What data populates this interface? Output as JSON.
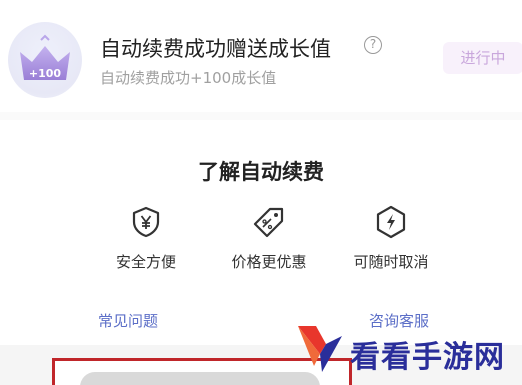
{
  "task": {
    "badge_text": "+100",
    "title": "自动续费成功赠送成长值",
    "help_symbol": "?",
    "subtitle": "自动续费成功+100成长值",
    "status": "进行中"
  },
  "info": {
    "title": "了解自动续费",
    "features": [
      {
        "label": "安全方便",
        "icon": "shield-yen-icon"
      },
      {
        "label": "价格更优惠",
        "icon": "price-tag-icon"
      },
      {
        "label": "可随时取消",
        "icon": "lightning-hexagon-icon"
      }
    ],
    "links": {
      "faq": "常见问题",
      "service": "咨询客服"
    }
  },
  "watermark": {
    "text": "看看手游网"
  },
  "colors": {
    "accent_purple": "#a58ad9",
    "link_blue": "#5b6ec7",
    "status_bg": "#f8f1fb",
    "status_text": "#c9a7dc",
    "watermark_blue": "#2a2e9a",
    "watermark_red": "#e8362c"
  }
}
